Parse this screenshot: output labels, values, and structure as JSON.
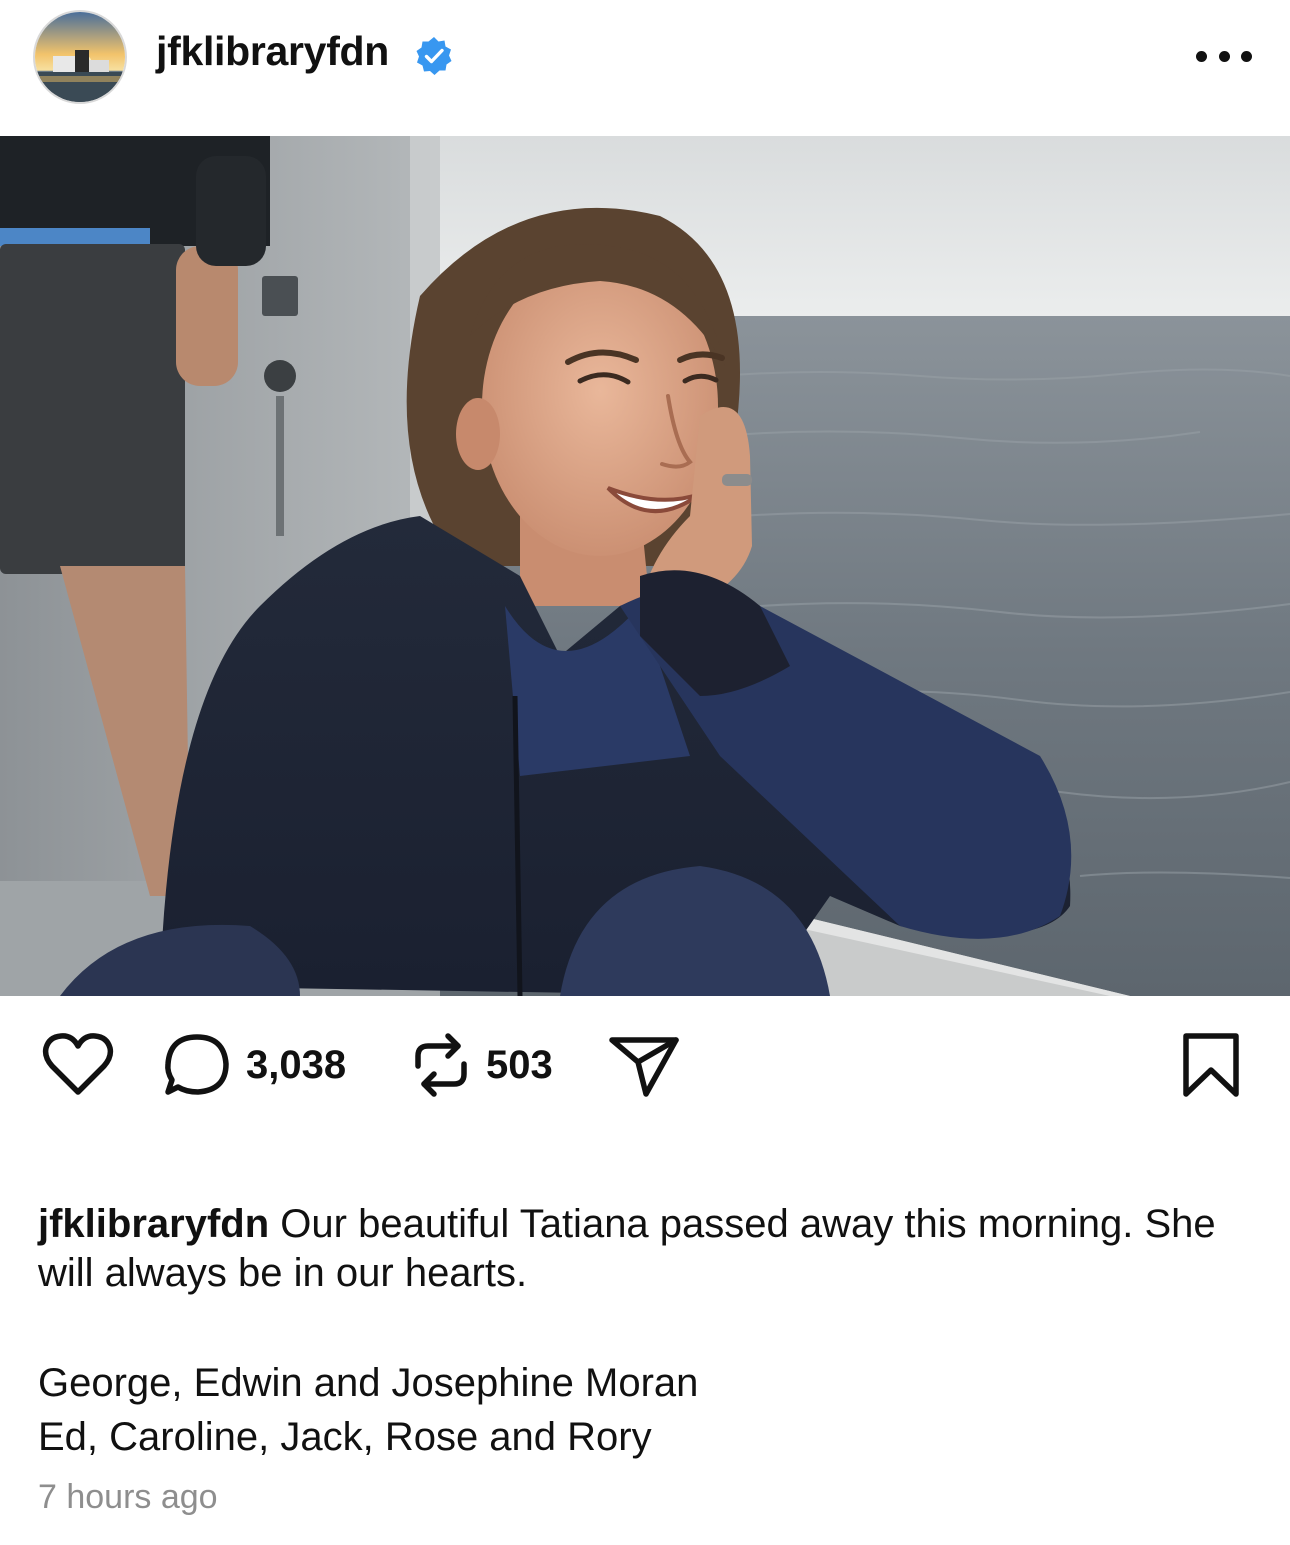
{
  "header": {
    "username": "jfklibraryfdn",
    "verified": true,
    "avatar_icon": "library-building-sunset-avatar",
    "more_icon": "more-dots-icon"
  },
  "photo": {
    "subject": "woman-smiling-on-boat"
  },
  "actions": {
    "like_icon": "heart-icon",
    "comment_icon": "comment-icon",
    "comments_count": "3,038",
    "repost_icon": "repost-icon",
    "reposts_count": "503",
    "share_icon": "send-icon",
    "save_icon": "bookmark-icon"
  },
  "caption": {
    "username": "jfklibraryfdn",
    "text": "Our beautiful Tatiana passed away this morning. She will always be in our hearts.",
    "signature_line_1": "George, Edwin and Josephine Moran",
    "signature_line_2": "Ed, Caroline, Jack, Rose and Rory"
  },
  "timestamp": "7 hours ago",
  "colors": {
    "verified_blue": "#3897f0",
    "text_primary": "#111111",
    "text_secondary": "#8e8e8e"
  }
}
